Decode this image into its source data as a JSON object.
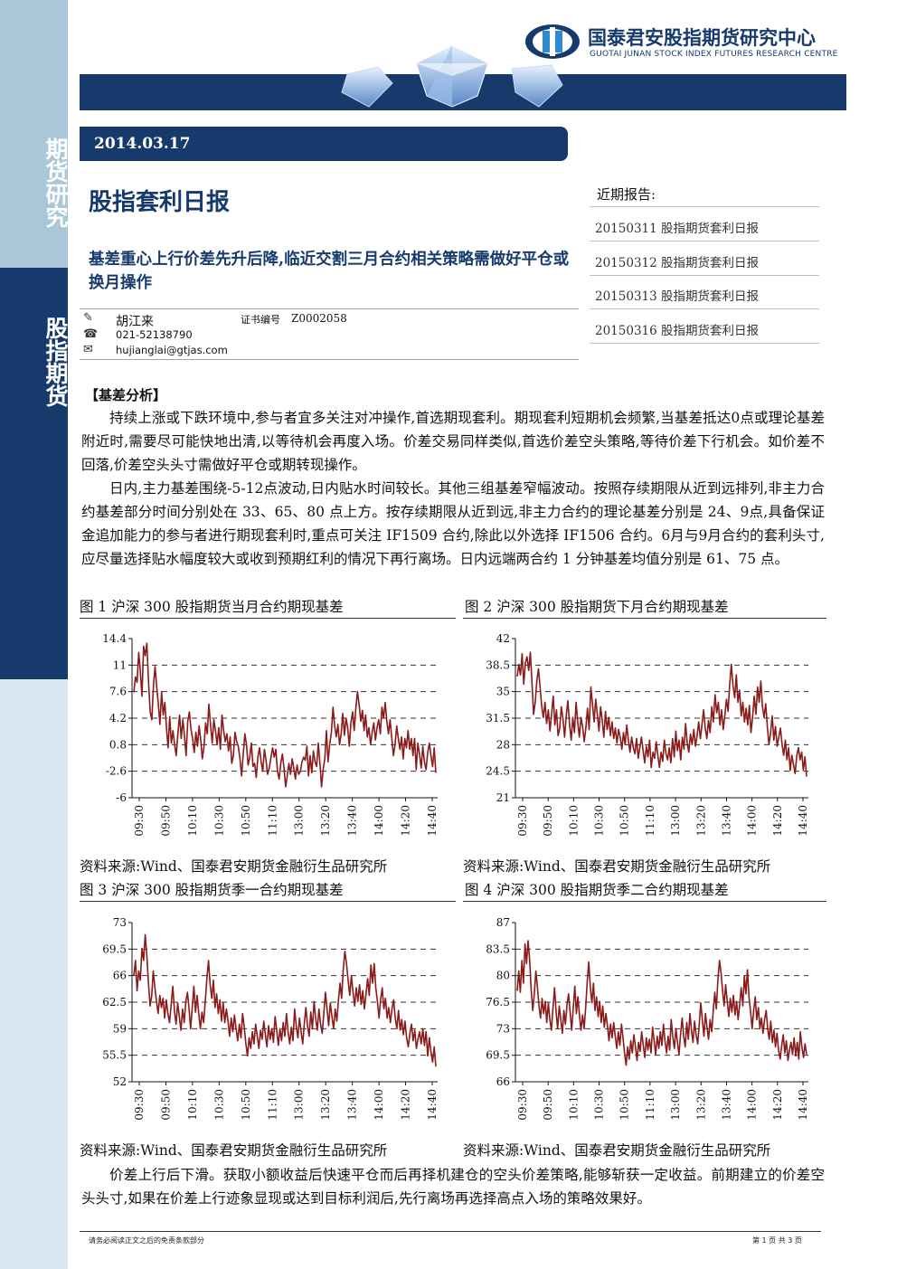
{
  "sidebar": {
    "top_label": "期货研究",
    "mid_label": "股指期货"
  },
  "header": {
    "org_cn": "国泰君安股指期货研究中心",
    "org_en": "GUOTAI JUNAN STOCK INDEX FUTURES RESEARCH CENTRE",
    "date": "2014.03.17",
    "title": "股指套利日报",
    "subtitle": "基差重心上行价差先升后降,临近交割三月合约相关策略需做好平仓或换月操作"
  },
  "author": {
    "name": "胡江来",
    "cert_label": "证书编号",
    "cert_no": "Z0002058",
    "phone": "021-52138790",
    "email": "hujianglai@gtjas.com"
  },
  "recent": {
    "heading": "近期报告:",
    "items": [
      "20150311 股指期货套利日报",
      "20150312 股指期货套利日报",
      "20150313 股指期货套利日报",
      "20150316 股指期货套利日报"
    ]
  },
  "analysis": {
    "heading": "【基差分析】",
    "p1": "持续上涨或下跌环境中,参与者宜多关注对冲操作,首选期现套利。期现套利短期机会频繁,当基差抵达0点或理论基差附近时,需要尽可能快地出清,以等待机会再度入场。价差交易同样类似,首选价差空头策略,等待价差下行机会。如价差不回落,价差空头头寸需做好平仓或期转现操作。",
    "p2": "日内,主力基差围绕-5-12点波动,日内贴水时间较长。其他三组基差窄幅波动。按照存续期限从近到远排列,非主力合约基差部分时间分别处在 33、65、80 点上方。按存续期限从近到远,非主力合约的理论基差分别是 24、9点,具备保证金追加能力的参与者进行期现套利时,重点可关注 IF1509 合约,除此以外选择 IF1506 合约。6月与9月合约的套利头寸,应尽量选择贴水幅度较大或收到预期红利的情况下再行离场。日内远端两合约 1 分钟基差均值分别是 61、75 点。",
    "p3": "价差上行后下滑。获取小额收益后快速平仓而后再择机建仓的空头价差策略,能够斩获一定收益。前期建立的价差空头头寸,如果在价差上行迹象显现或达到目标利润后,先行离场再选择高点入场的策略效果好。"
  },
  "source_text": "资料来源:Wind、国泰君安期货金融衍生品研究所",
  "footer": {
    "disclaimer": "请务必阅读正文之后的免责条款部分",
    "page": "第 1 页 共 3 页"
  },
  "colors": {
    "navy": "#163a6c",
    "line": "#8b1a1a",
    "side_light": "#a9c7d9"
  },
  "chart_data": [
    {
      "type": "line",
      "title": "图 1 沪深 300 股指期货当月合约期现基差",
      "yticks": [
        "14.4",
        "11",
        "7.6",
        "4.2",
        "0.8",
        "-2.6",
        "-6"
      ],
      "ylim": [
        -6,
        14.4
      ],
      "xticks": [
        "09:30",
        "09:50",
        "10:10",
        "10:30",
        "10:50",
        "11:10",
        "13:00",
        "13:20",
        "13:40",
        "14:00",
        "14:20",
        "14:40"
      ],
      "grid": true,
      "values": [
        7.5,
        9.5,
        8.8,
        12.6,
        10.2,
        7.0,
        13.4,
        12.2,
        13.8,
        9.0,
        5.0,
        4.0,
        8.3,
        10.8,
        8.2,
        6.0,
        3.4,
        7.6,
        4.6,
        6.2,
        3.0,
        0.4,
        4.4,
        1.0,
        2.6,
        0.8,
        -0.6,
        2.2,
        4.6,
        1.6,
        4.0,
        2.0,
        -0.6,
        3.8,
        5.0,
        2.8,
        1.6,
        -0.2,
        2.4,
        0.6,
        3.2,
        1.4,
        -1.0,
        0.6,
        3.6,
        2.2,
        6.0,
        3.2,
        1.0,
        4.0,
        2.6,
        0.8,
        3.0,
        0.2,
        4.6,
        2.6,
        1.2,
        2.2,
        0.0,
        1.8,
        -1.6,
        -0.6,
        2.4,
        1.2,
        0.6,
        -1.0,
        -3.2,
        -0.4,
        2.2,
        0.8,
        -1.8,
        -0.8,
        1.0,
        -2.0,
        -1.6,
        -3.4,
        -0.8,
        0.4,
        -1.4,
        -2.6,
        0.2,
        -1.2,
        -3.0,
        -2.2,
        -0.8,
        0.4,
        -0.8,
        0.2,
        -2.6,
        -3.6,
        -1.6,
        -0.4,
        -2.2,
        -4.6,
        -3.2,
        -1.6,
        -3.0,
        -1.0,
        -2.2,
        -3.6,
        -1.8,
        -3.0,
        -2.6,
        -1.4,
        -0.8,
        -1.2,
        0.6,
        -3.2,
        -0.6,
        -2.8,
        0.0,
        -1.4,
        -2.0,
        1.0,
        -1.6,
        -4.6,
        -2.4,
        -1.0,
        2.6,
        -1.4,
        0.8,
        2.4,
        5.6,
        3.2,
        1.8,
        3.4,
        0.8,
        2.2,
        4.8,
        2.0,
        4.2,
        3.0,
        0.6,
        3.6,
        5.0,
        2.6,
        5.4,
        7.6,
        6.0,
        3.8,
        5.2,
        2.6,
        4.6,
        1.8,
        3.0,
        0.8,
        2.4,
        3.6,
        1.4,
        3.0,
        4.0,
        2.2,
        5.6,
        4.2,
        6.2,
        3.8,
        2.2,
        4.0,
        1.6,
        -0.6,
        0.8,
        3.2,
        1.6,
        0.2,
        1.8,
        -1.0,
        1.6,
        0.4,
        2.6,
        0.2,
        1.6,
        -0.6,
        1.6,
        -2.4,
        1.0,
        -0.4,
        -2.2,
        0.6,
        -1.4,
        -2.4,
        -0.2,
        1.0,
        -0.6,
        -2.0,
        0.4,
        -2.8
      ]
    },
    {
      "type": "line",
      "title": "图 2 沪深 300 股指期货下月合约期现基差",
      "yticks": [
        "42",
        "38.5",
        "35",
        "31.5",
        "28",
        "24.5",
        "21"
      ],
      "ylim": [
        21,
        42
      ],
      "xticks": [
        "09:30",
        "09:50",
        "10:10",
        "10:30",
        "10:50",
        "11:10",
        "13:00",
        "13:20",
        "13:40",
        "14:00",
        "14:20",
        "14:40"
      ],
      "grid": true,
      "values": [
        37.0,
        38.6,
        37.2,
        40.0,
        36.0,
        38.8,
        39.6,
        37.8,
        40.2,
        36.2,
        32.0,
        33.6,
        36.4,
        38.0,
        35.6,
        33.0,
        31.6,
        33.6,
        30.8,
        32.6,
        29.8,
        32.0,
        34.4,
        30.6,
        32.6,
        29.2,
        30.2,
        33.0,
        31.4,
        29.0,
        31.8,
        33.8,
        30.6,
        28.6,
        31.6,
        29.6,
        33.6,
        31.0,
        29.0,
        31.6,
        30.4,
        28.4,
        30.2,
        32.8,
        30.0,
        35.6,
        33.4,
        31.0,
        34.0,
        32.0,
        29.8,
        33.0,
        31.2,
        29.0,
        32.4,
        30.0,
        31.6,
        29.2,
        31.0,
        28.8,
        30.2,
        28.2,
        30.0,
        29.0,
        27.4,
        29.6,
        28.0,
        30.6,
        28.6,
        27.0,
        29.0,
        27.6,
        26.8,
        28.8,
        26.2,
        27.6,
        29.0,
        27.2,
        25.6,
        27.8,
        26.4,
        28.6,
        25.0,
        27.0,
        26.2,
        28.4,
        26.6,
        25.0,
        27.0,
        25.8,
        28.6,
        26.8,
        26.0,
        27.6,
        25.6,
        28.8,
        26.4,
        29.8,
        27.2,
        28.6,
        26.0,
        29.0,
        27.4,
        30.8,
        28.2,
        27.0,
        29.4,
        28.0,
        30.0,
        27.8,
        29.2,
        31.0,
        28.8,
        30.6,
        32.6,
        30.2,
        28.8,
        31.2,
        29.6,
        33.0,
        31.0,
        34.6,
        32.2,
        33.6,
        30.6,
        32.6,
        30.0,
        31.8,
        34.0,
        32.4,
        36.0,
        38.6,
        35.8,
        34.2,
        37.2,
        33.6,
        35.2,
        31.8,
        33.6,
        31.0,
        32.8,
        30.6,
        33.2,
        29.6,
        31.6,
        34.4,
        32.0,
        35.6,
        33.6,
        36.4,
        33.0,
        31.6,
        33.4,
        30.4,
        28.0,
        29.6,
        31.8,
        28.6,
        30.4,
        27.8,
        29.0,
        30.2,
        28.0,
        26.6,
        28.6,
        26.0,
        27.6,
        24.6,
        26.6,
        25.4,
        24.2,
        26.6,
        27.6,
        26.0,
        27.0,
        24.6,
        26.4,
        23.8
      ]
    },
    {
      "type": "line",
      "title": "图 3 沪深 300 股指期货季一合约期现基差",
      "yticks": [
        "73",
        "69.5",
        "66",
        "62.5",
        "59",
        "55.5",
        "52"
      ],
      "ylim": [
        52,
        73
      ],
      "xticks": [
        "09:30",
        "09:50",
        "10:10",
        "10:30",
        "10:50",
        "11:10",
        "13:00",
        "13:20",
        "13:40",
        "14:00",
        "14:20",
        "14:40"
      ],
      "grid": true,
      "values": [
        66.0,
        68.0,
        64.0,
        66.6,
        65.4,
        69.6,
        68.0,
        71.4,
        68.6,
        65.0,
        62.0,
        63.4,
        66.6,
        64.4,
        62.6,
        61.0,
        63.4,
        61.8,
        63.0,
        60.4,
        62.8,
        61.0,
        59.8,
        62.2,
        64.6,
        61.4,
        59.6,
        62.4,
        60.6,
        58.8,
        61.6,
        59.8,
        62.6,
        63.8,
        61.6,
        59.0,
        61.8,
        64.6,
        61.2,
        63.4,
        61.0,
        59.0,
        61.2,
        59.8,
        62.6,
        65.6,
        68.0,
        64.8,
        63.0,
        65.4,
        61.8,
        63.6,
        61.0,
        62.8,
        60.0,
        62.4,
        59.8,
        61.6,
        60.0,
        58.0,
        60.4,
        58.6,
        60.8,
        59.0,
        57.4,
        59.6,
        57.8,
        61.0,
        59.2,
        57.0,
        55.4,
        57.8,
        56.4,
        58.6,
        57.0,
        59.6,
        58.0,
        56.4,
        58.8,
        57.6,
        60.0,
        58.2,
        56.6,
        59.4,
        57.6,
        59.0,
        57.2,
        60.6,
        58.8,
        56.8,
        59.0,
        57.4,
        59.8,
        58.0,
        61.0,
        58.6,
        57.0,
        59.2,
        57.4,
        61.6,
        59.4,
        57.8,
        60.4,
        58.6,
        57.0,
        59.6,
        61.8,
        59.4,
        58.0,
        61.2,
        59.0,
        62.6,
        60.4,
        58.8,
        61.6,
        59.6,
        58.4,
        61.0,
        63.8,
        61.6,
        59.4,
        62.4,
        60.6,
        59.0,
        61.6,
        60.0,
        62.8,
        65.0,
        63.0,
        66.8,
        69.2,
        67.6,
        65.4,
        63.4,
        66.0,
        63.8,
        62.0,
        64.4,
        62.6,
        64.8,
        62.2,
        64.0,
        61.6,
        63.6,
        65.6,
        63.4,
        67.4,
        65.0,
        67.6,
        64.4,
        62.6,
        60.4,
        62.8,
        64.4,
        61.6,
        63.0,
        60.4,
        61.8,
        59.8,
        61.6,
        62.8,
        60.4,
        59.0,
        61.4,
        58.8,
        60.2,
        58.2,
        60.0,
        57.8,
        56.6,
        58.4,
        59.6,
        57.4,
        58.8,
        56.4,
        57.6,
        58.6,
        57.0,
        59.0,
        56.8,
        58.6,
        55.4,
        57.8,
        56.0,
        54.6,
        56.6,
        54.0
      ]
    },
    {
      "type": "line",
      "title": "图 4 沪深 300 股指期货季二合约期现基差",
      "yticks": [
        "87",
        "83.5",
        "80",
        "76.5",
        "73",
        "69.5",
        "66"
      ],
      "ylim": [
        66,
        87
      ],
      "xticks": [
        "09:30",
        "09:50",
        "10:10",
        "10:30",
        "10:50",
        "11:10",
        "13:00",
        "13:20",
        "13:40",
        "14:00",
        "14:20",
        "14:40"
      ],
      "grid": true,
      "values": [
        78.0,
        80.6,
        77.8,
        82.0,
        79.0,
        84.2,
        81.6,
        84.6,
        82.0,
        78.0,
        75.4,
        77.6,
        80.6,
        78.4,
        76.0,
        74.4,
        77.0,
        75.0,
        76.6,
        73.8,
        76.4,
        74.2,
        72.8,
        75.8,
        78.4,
        75.2,
        73.0,
        76.0,
        74.2,
        72.4,
        75.4,
        73.6,
        76.2,
        77.6,
        75.2,
        72.8,
        75.6,
        78.6,
        75.0,
        77.2,
        74.8,
        72.8,
        74.8,
        73.0,
        75.8,
        79.2,
        81.8,
        78.4,
        76.4,
        79.0,
        75.4,
        77.2,
        74.6,
        76.6,
        73.8,
        76.0,
        73.2,
        75.0,
        73.4,
        71.4,
        73.6,
        71.8,
        73.8,
        72.0,
        70.4,
        72.6,
        70.8,
        73.6,
        71.8,
        69.8,
        68.2,
        70.6,
        69.0,
        71.4,
        69.8,
        72.2,
        70.6,
        68.8,
        71.2,
        70.0,
        72.6,
        70.8,
        69.2,
        71.8,
        70.2,
        71.6,
        69.8,
        73.2,
        71.4,
        69.6,
        72.0,
        70.4,
        72.6,
        70.8,
        73.6,
        71.4,
        69.8,
        72.0,
        70.2,
        74.2,
        72.0,
        70.4,
        73.0,
        71.2,
        69.6,
        72.2,
        74.4,
        72.0,
        70.6,
        73.8,
        71.6,
        75.0,
        72.8,
        71.2,
        74.0,
        72.2,
        71.0,
        73.6,
        76.4,
        74.2,
        72.0,
        75.0,
        73.2,
        71.6,
        74.2,
        72.6,
        75.4,
        77.8,
        75.6,
        79.4,
        82.0,
        80.4,
        78.0,
        76.0,
        78.8,
        76.6,
        74.6,
        77.0,
        75.2,
        77.4,
        74.8,
        76.6,
        74.2,
        76.2,
        78.4,
        76.0,
        80.0,
        77.6,
        80.8,
        77.2,
        75.2,
        73.0,
        75.4,
        77.2,
        74.2,
        75.8,
        73.0,
        74.4,
        72.4,
        74.2,
        75.4,
        73.0,
        71.6,
        74.0,
        71.2,
        72.8,
        70.6,
        72.4,
        70.2,
        69.0,
        70.8,
        72.2,
        69.8,
        71.4,
        68.8,
        70.2,
        71.2,
        69.6,
        71.8,
        69.4,
        71.2,
        69.0,
        72.6,
        70.6,
        69.2,
        71.0,
        69.6
      ]
    }
  ]
}
